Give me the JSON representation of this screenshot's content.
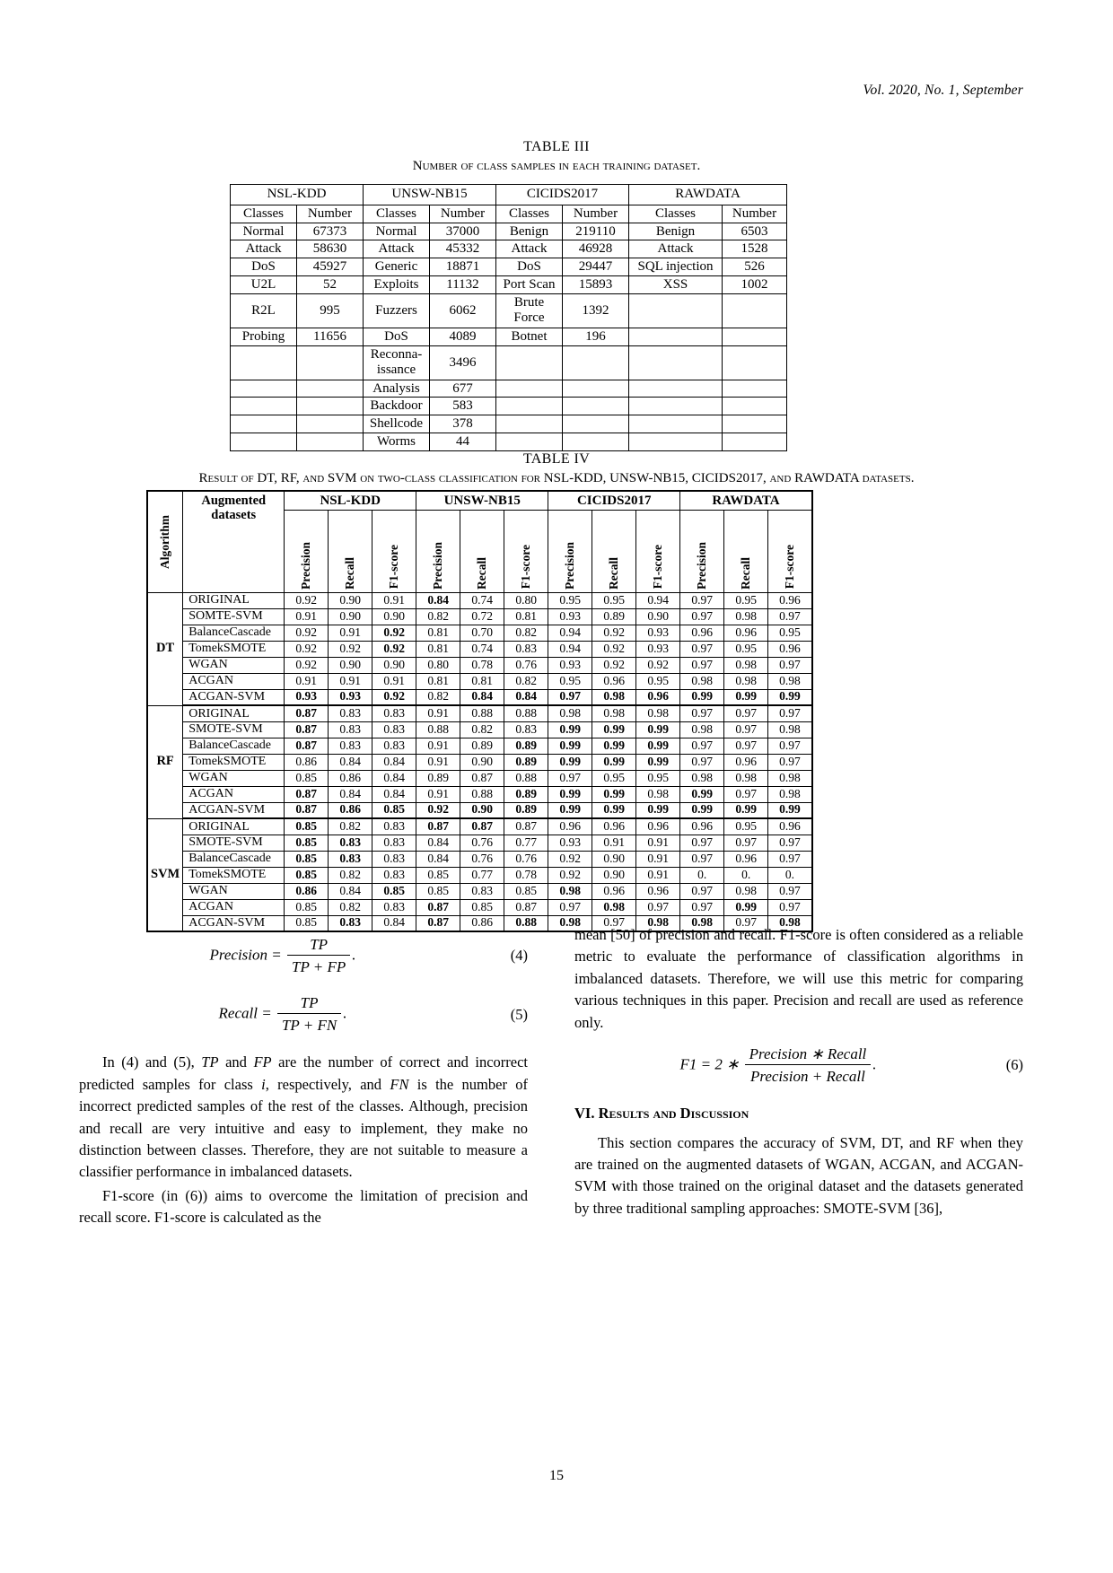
{
  "running_head": "Vol. 2020, No. 1, September",
  "page_number": "15",
  "table3": {
    "number": "TABLE III",
    "title": "Number of class samples in each training dataset.",
    "groups": [
      "NSL-KDD",
      "UNSW-NB15",
      "CICIDS2017",
      "RAWDATA"
    ],
    "subheaders": [
      "Classes",
      "Number",
      "Classes",
      "Number",
      "Classes",
      "Number",
      "Classes",
      "Number"
    ],
    "rows": [
      [
        "Normal",
        "67373",
        "Normal",
        "37000",
        "Benign",
        "219110",
        "Benign",
        "6503"
      ],
      [
        "Attack",
        "58630",
        "Attack",
        "45332",
        "Attack",
        "46928",
        "Attack",
        "1528"
      ],
      [
        "DoS",
        "45927",
        "Generic",
        "18871",
        "DoS",
        "29447",
        "SQL injection",
        "526"
      ],
      [
        "U2L",
        "52",
        "Exploits",
        "11132",
        "Port Scan",
        "15893",
        "XSS",
        "1002"
      ],
      [
        "R2L",
        "995",
        "Fuzzers",
        "6062",
        "Brute\nForce",
        "1392",
        "",
        ""
      ],
      [
        "Probing",
        "11656",
        "DoS",
        "4089",
        "Botnet",
        "196",
        "",
        ""
      ],
      [
        "",
        "",
        "Reconna-\nissance",
        "3496",
        "",
        "",
        "",
        ""
      ],
      [
        "",
        "",
        "Analysis",
        "677",
        "",
        "",
        "",
        ""
      ],
      [
        "",
        "",
        "Backdoor",
        "583",
        "",
        "",
        "",
        ""
      ],
      [
        "",
        "",
        "Shellcode",
        "378",
        "",
        "",
        "",
        ""
      ],
      [
        "",
        "",
        "Worms",
        "44",
        "",
        "",
        "",
        ""
      ]
    ]
  },
  "table4": {
    "number": "TABLE IV",
    "title_pre": "Result of DT, RF, and SVM on two-class classification for ",
    "title_mid": "NSL-KDD, UNSW-NB15, CICIDS2017,",
    "title_and": " and ",
    "title_post": "RAWDATA datasets.",
    "col_algorithm": "Algorithm",
    "col_augmented_l1": "Augmented",
    "col_augmented_l2": "datasets",
    "groups": [
      "NSL-KDD",
      "UNSW-NB15",
      "CICIDS2017",
      "RAWDATA"
    ],
    "metrics": [
      "Precision",
      "Recall",
      "F1-score"
    ],
    "blocks": [
      {
        "algorithm": "DT",
        "rows": [
          {
            "dataset": "ORIGINAL",
            "values": [
              "0.92",
              "0.90",
              "0.91",
              "0.84",
              "0.74",
              "0.80",
              "0.95",
              "0.95",
              "0.94",
              "0.97",
              "0.95",
              "0.96"
            ],
            "bold": [
              false,
              false,
              false,
              true,
              false,
              false,
              false,
              false,
              false,
              false,
              false,
              false
            ]
          },
          {
            "dataset": "SOMTE-SVM",
            "values": [
              "0.91",
              "0.90",
              "0.90",
              "0.82",
              "0.72",
              "0.81",
              "0.93",
              "0.89",
              "0.90",
              "0.97",
              "0.98",
              "0.97"
            ],
            "bold": [
              false,
              false,
              false,
              false,
              false,
              false,
              false,
              false,
              false,
              false,
              false,
              false
            ]
          },
          {
            "dataset": "BalanceCascade",
            "values": [
              "0.92",
              "0.91",
              "0.92",
              "0.81",
              "0.70",
              "0.82",
              "0.94",
              "0.92",
              "0.93",
              "0.96",
              "0.96",
              "0.95"
            ],
            "bold": [
              false,
              false,
              true,
              false,
              false,
              false,
              false,
              false,
              false,
              false,
              false,
              false
            ]
          },
          {
            "dataset": "TomekSMOTE",
            "values": [
              "0.92",
              "0.92",
              "0.92",
              "0.81",
              "0.74",
              "0.83",
              "0.94",
              "0.92",
              "0.93",
              "0.97",
              "0.95",
              "0.96"
            ],
            "bold": [
              false,
              false,
              true,
              false,
              false,
              false,
              false,
              false,
              false,
              false,
              false,
              false
            ]
          },
          {
            "dataset": "WGAN",
            "values": [
              "0.92",
              "0.90",
              "0.90",
              "0.80",
              "0.78",
              "0.76",
              "0.93",
              "0.92",
              "0.92",
              "0.97",
              "0.98",
              "0.97"
            ],
            "bold": [
              false,
              false,
              false,
              false,
              false,
              false,
              false,
              false,
              false,
              false,
              false,
              false
            ]
          },
          {
            "dataset": "ACGAN",
            "values": [
              "0.91",
              "0.91",
              "0.91",
              "0.81",
              "0.81",
              "0.82",
              "0.95",
              "0.96",
              "0.95",
              "0.98",
              "0.98",
              "0.98"
            ],
            "bold": [
              false,
              false,
              false,
              false,
              false,
              false,
              false,
              false,
              false,
              false,
              false,
              false
            ]
          },
          {
            "dataset": "ACGAN-SVM",
            "values": [
              "0.93",
              "0.93",
              "0.92",
              "0.82",
              "0.84",
              "0.84",
              "0.97",
              "0.98",
              "0.96",
              "0.99",
              "0.99",
              "0.99"
            ],
            "bold": [
              true,
              true,
              true,
              false,
              true,
              true,
              true,
              true,
              true,
              true,
              true,
              true
            ]
          }
        ]
      },
      {
        "algorithm": "RF",
        "rows": [
          {
            "dataset": "ORIGINAL",
            "values": [
              "0.87",
              "0.83",
              "0.83",
              "0.91",
              "0.88",
              "0.88",
              "0.98",
              "0.98",
              "0.98",
              "0.97",
              "0.97",
              "0.97"
            ],
            "bold": [
              true,
              false,
              false,
              false,
              false,
              false,
              false,
              false,
              false,
              false,
              false,
              false
            ]
          },
          {
            "dataset": "SMOTE-SVM",
            "values": [
              "0.87",
              "0.83",
              "0.83",
              "0.88",
              "0.82",
              "0.83",
              "0.99",
              "0.99",
              "0.99",
              "0.98",
              "0.97",
              "0.98"
            ],
            "bold": [
              true,
              false,
              false,
              false,
              false,
              false,
              true,
              true,
              true,
              false,
              false,
              false
            ]
          },
          {
            "dataset": "BalanceCascade",
            "values": [
              "0.87",
              "0.83",
              "0.83",
              "0.91",
              "0.89",
              "0.89",
              "0.99",
              "0.99",
              "0.99",
              "0.97",
              "0.97",
              "0.97"
            ],
            "bold": [
              true,
              false,
              false,
              false,
              false,
              true,
              true,
              true,
              true,
              false,
              false,
              false
            ]
          },
          {
            "dataset": "TomekSMOTE",
            "values": [
              "0.86",
              "0.84",
              "0.84",
              "0.91",
              "0.90",
              "0.89",
              "0.99",
              "0.99",
              "0.99",
              "0.97",
              "0.96",
              "0.97"
            ],
            "bold": [
              false,
              false,
              false,
              false,
              false,
              true,
              true,
              true,
              true,
              false,
              false,
              false
            ]
          },
          {
            "dataset": "WGAN",
            "values": [
              "0.85",
              "0.86",
              "0.84",
              "0.89",
              "0.87",
              "0.88",
              "0.97",
              "0.95",
              "0.95",
              "0.98",
              "0.98",
              "0.98"
            ],
            "bold": [
              false,
              false,
              false,
              false,
              false,
              false,
              false,
              false,
              false,
              false,
              false,
              false
            ]
          },
          {
            "dataset": "ACGAN",
            "values": [
              "0.87",
              "0.84",
              "0.84",
              "0.91",
              "0.88",
              "0.89",
              "0.99",
              "0.99",
              "0.98",
              "0.99",
              "0.97",
              "0.98"
            ],
            "bold": [
              true,
              false,
              false,
              false,
              false,
              true,
              true,
              true,
              false,
              true,
              false,
              false
            ]
          },
          {
            "dataset": "ACGAN-SVM",
            "values": [
              "0.87",
              "0.86",
              "0.85",
              "0.92",
              "0.90",
              "0.89",
              "0.99",
              "0.99",
              "0.99",
              "0.99",
              "0.99",
              "0.99"
            ],
            "bold": [
              true,
              true,
              true,
              true,
              true,
              true,
              true,
              true,
              true,
              true,
              true,
              true
            ]
          }
        ]
      },
      {
        "algorithm": "SVM",
        "rows": [
          {
            "dataset": "ORIGINAL",
            "values": [
              "0.85",
              "0.82",
              "0.83",
              "0.87",
              "0.87",
              "0.87",
              "0.96",
              "0.96",
              "0.96",
              "0.96",
              "0.95",
              "0.96"
            ],
            "bold": [
              true,
              false,
              false,
              true,
              true,
              false,
              false,
              false,
              false,
              false,
              false,
              false
            ]
          },
          {
            "dataset": "SMOTE-SVM",
            "values": [
              "0.85",
              "0.83",
              "0.83",
              "0.84",
              "0.76",
              "0.77",
              "0.93",
              "0.91",
              "0.91",
              "0.97",
              "0.97",
              "0.97"
            ],
            "bold": [
              true,
              true,
              false,
              false,
              false,
              false,
              false,
              false,
              false,
              false,
              false,
              false
            ]
          },
          {
            "dataset": "BalanceCascade",
            "values": [
              "0.85",
              "0.83",
              "0.83",
              "0.84",
              "0.76",
              "0.76",
              "0.92",
              "0.90",
              "0.91",
              "0.97",
              "0.96",
              "0.97"
            ],
            "bold": [
              true,
              true,
              false,
              false,
              false,
              false,
              false,
              false,
              false,
              false,
              false,
              false
            ]
          },
          {
            "dataset": "TomekSMOTE",
            "values": [
              "0.85",
              "0.82",
              "0.83",
              "0.85",
              "0.77",
              "0.78",
              "0.92",
              "0.90",
              "0.91",
              "0.",
              "0.",
              "0."
            ],
            "bold": [
              true,
              false,
              false,
              false,
              false,
              false,
              false,
              false,
              false,
              false,
              false,
              false
            ]
          },
          {
            "dataset": "WGAN",
            "values": [
              "0.86",
              "0.84",
              "0.85",
              "0.85",
              "0.83",
              "0.85",
              "0.98",
              "0.96",
              "0.96",
              "0.97",
              "0.98",
              "0.97"
            ],
            "bold": [
              true,
              false,
              true,
              false,
              false,
              false,
              true,
              false,
              false,
              false,
              false,
              false
            ]
          },
          {
            "dataset": "ACGAN",
            "values": [
              "0.85",
              "0.82",
              "0.83",
              "0.87",
              "0.85",
              "0.87",
              "0.97",
              "0.98",
              "0.97",
              "0.97",
              "0.99",
              "0.97"
            ],
            "bold": [
              false,
              false,
              false,
              true,
              false,
              false,
              false,
              true,
              false,
              false,
              true,
              false
            ]
          },
          {
            "dataset": "ACGAN-SVM",
            "values": [
              "0.85",
              "0.83",
              "0.84",
              "0.87",
              "0.86",
              "0.88",
              "0.98",
              "0.97",
              "0.98",
              "0.98",
              "0.97",
              "0.98"
            ],
            "bold": [
              false,
              true,
              false,
              true,
              false,
              true,
              true,
              false,
              true,
              true,
              false,
              true
            ]
          }
        ]
      }
    ]
  },
  "equations": {
    "eq4": {
      "lhs": "Precision =",
      "num": "TP",
      "den": "TP + FP",
      "tail": ".",
      "number": "(4)"
    },
    "eq5": {
      "lhs": "Recall =",
      "num": "TP",
      "den": "TP + FN",
      "tail": ".",
      "number": "(5)"
    },
    "eq6": {
      "lhs": "F1 = 2 ∗",
      "num": "Precision ∗ Recall",
      "den": "Precision + Recall",
      "tail": ".",
      "number": "(6)"
    }
  },
  "left_column": {
    "para1_a": "In (4) and (5), ",
    "para1_b": "TP",
    "para1_c": " and ",
    "para1_d": "FP",
    "para1_e": " are the number of correct and incorrect predicted samples for class ",
    "para1_f": "i",
    "para1_g": ", respectively, and ",
    "para1_h": "FN",
    "para1_i": " is the number of incorrect predicted samples of the rest of the classes. Although, precision and recall are very intuitive and easy to implement, they make no distinction between classes. Therefore, they are not suitable to measure a classifier performance in imbalanced datasets.",
    "para2": "F1-score (in (6)) aims to overcome the limitation of precision and recall score. F1-score is calculated as the"
  },
  "right_column": {
    "para1": "mean [50] of precision and recall. F1-score is often considered as a reliable metric to evaluate the performance of classification algorithms in imbalanced datasets. Therefore, we will use this metric for comparing various techniques in this paper. Precision and recall are used as reference only.",
    "section_number": "VI.",
    "section_title": "Results and Discussion",
    "para2": "This section compares the accuracy of SVM, DT, and RF when they are trained on the augmented datasets of WGAN, ACGAN, and ACGAN-SVM with those trained on the original dataset and the datasets generated by three traditional sampling approaches: SMOTE-SVM [36],"
  }
}
